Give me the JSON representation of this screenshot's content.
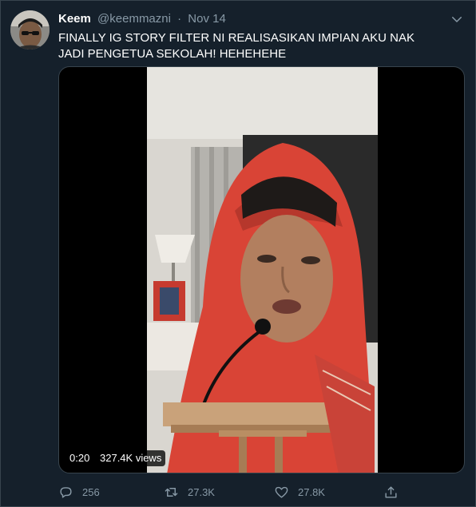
{
  "tweet": {
    "author_name": "Keem",
    "author_handle": "@keemmazni",
    "separator": "·",
    "date": "Nov 14",
    "text": "FINALLY IG STORY FILTER NI REALISASIKAN IMPIAN AKU NAK JADI PENGETUA SEKOLAH! HEHEHEHE"
  },
  "video": {
    "duration": "0:20",
    "views": "327.4K views"
  },
  "actions": {
    "replies": "256",
    "retweets": "27.3K",
    "likes": "27.8K"
  },
  "icons": {
    "menu": "chevron-down-icon",
    "reply": "reply-icon",
    "retweet": "retweet-icon",
    "like": "heart-icon",
    "share": "share-icon"
  },
  "colors": {
    "background": "#15202b",
    "border": "#38444d",
    "muted_text": "#8899a6",
    "primary_text": "#ffffff",
    "scarf": "#e0443a"
  }
}
